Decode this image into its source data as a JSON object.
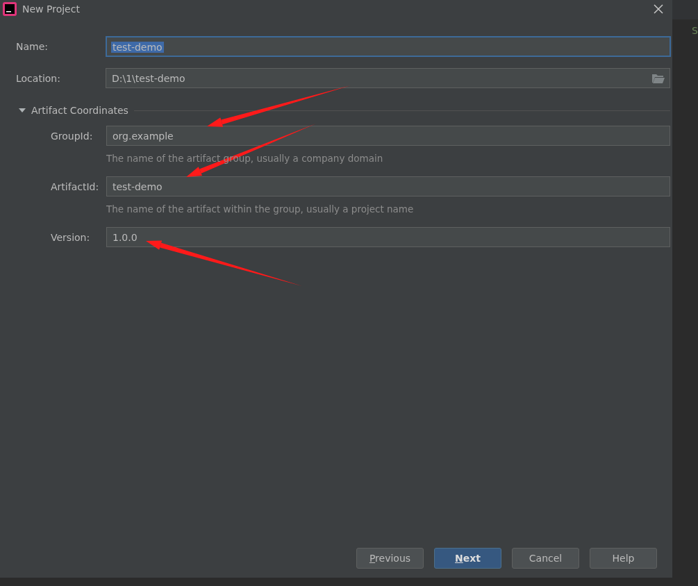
{
  "window": {
    "title": "New Project"
  },
  "fields": [
    {
      "label": "Name:",
      "value": "test-demo",
      "focused": true,
      "browse": false
    },
    {
      "label": "Location:",
      "value": "D:\\1\\test-demo",
      "focused": false,
      "browse": true
    }
  ],
  "section": {
    "title": "Artifact Coordinates",
    "expanded": true,
    "fields": [
      {
        "label": "GroupId:",
        "value": "org.example",
        "hint": "The name of the artifact group, usually a company domain"
      },
      {
        "label": "ArtifactId:",
        "value": "test-demo",
        "hint": "The name of the artifact within the group, usually a project name"
      },
      {
        "label": "Version:",
        "value": "1.0.0"
      }
    ]
  },
  "buttons": [
    {
      "label": "Previous",
      "mnemonic": true,
      "primary": false
    },
    {
      "label": "Next",
      "mnemonic": true,
      "primary": true
    },
    {
      "label": "Cancel",
      "mnemonic": false,
      "primary": false
    },
    {
      "label": "Help",
      "mnemonic": false,
      "primary": false
    }
  ],
  "background_editor": {
    "text": "S"
  }
}
